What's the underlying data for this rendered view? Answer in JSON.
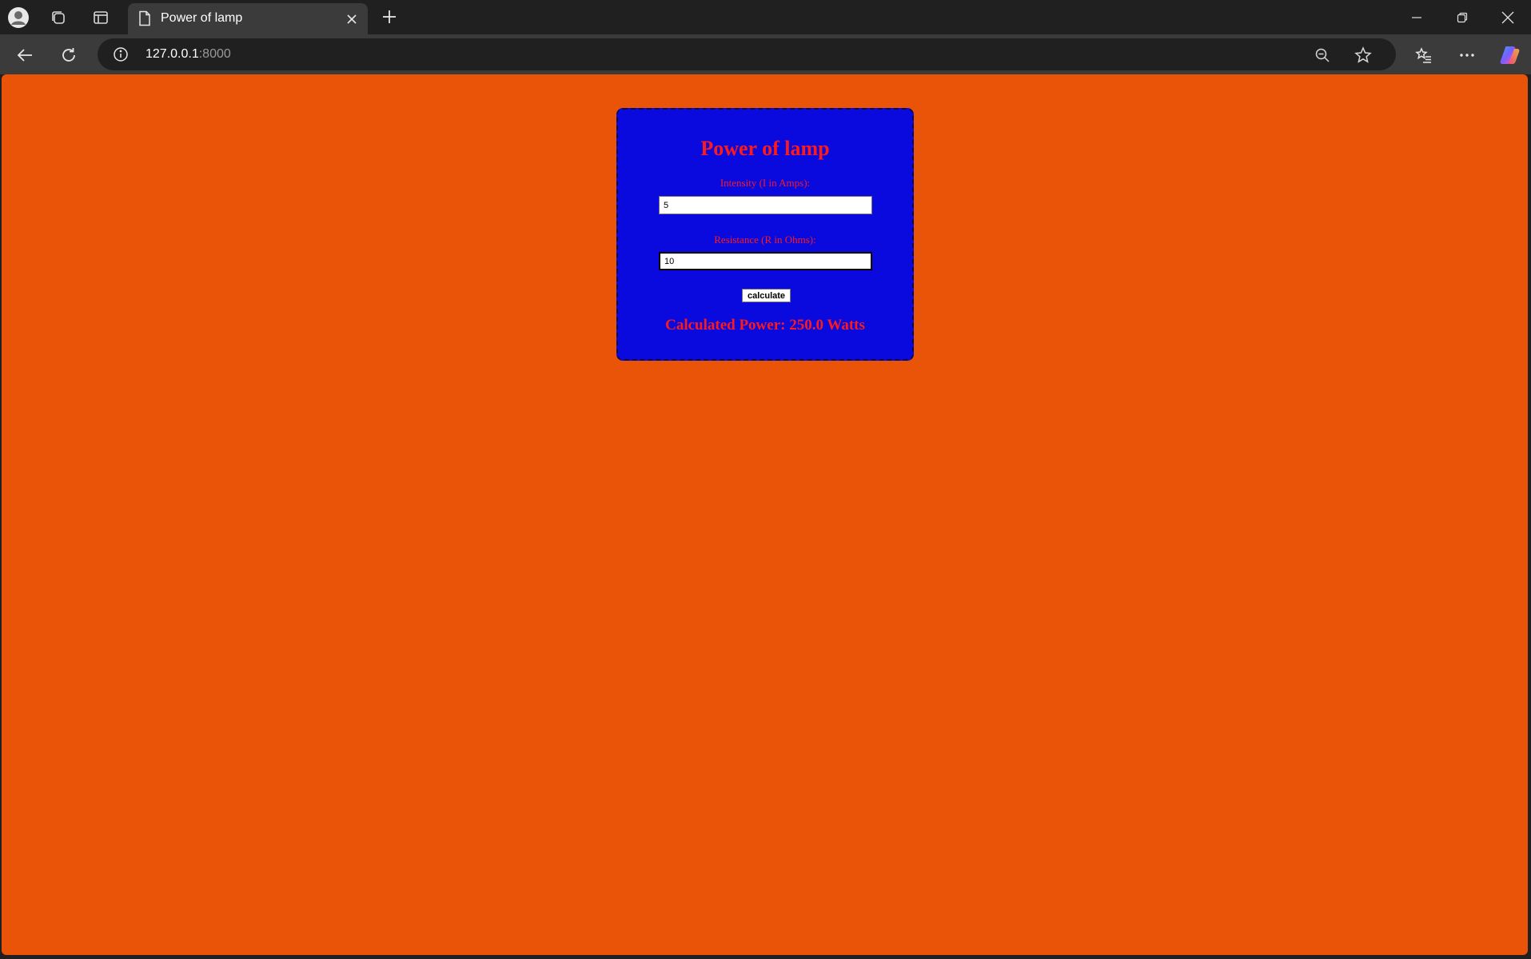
{
  "browser": {
    "tab": {
      "title": "Power of lamp"
    },
    "address": {
      "host": "127.0.0.1",
      "port": ":8000"
    },
    "icons": {
      "profile": "profile-icon",
      "collections": "collections-icon",
      "sidebar": "sidebar-icon",
      "page": "page-icon",
      "close_tab": "close-icon",
      "new_tab": "plus-icon",
      "minimize": "minimize-icon",
      "restore": "restore-icon",
      "close_window": "close-icon",
      "back": "back-arrow-icon",
      "refresh": "refresh-icon",
      "site_info": "info-icon",
      "zoom": "zoom-out-icon",
      "favorite": "star-icon",
      "favorites": "favorites-icon",
      "more": "more-icon",
      "copilot": "copilot-icon"
    }
  },
  "page": {
    "background_color": "#ea5409",
    "card_color": "#0a0adf",
    "text_color": "#ff1a1a",
    "title": "Power of lamp",
    "intensity": {
      "label": "Intensity (I in Amps):",
      "value": "5"
    },
    "resistance": {
      "label": "Resistance (R in Ohms):",
      "value": "10"
    },
    "calculate_label": "calculate",
    "result": "Calculated Power: 250.0 Watts"
  }
}
